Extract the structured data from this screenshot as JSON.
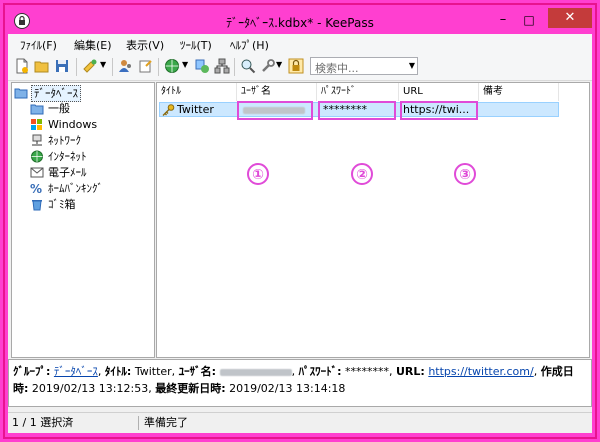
{
  "window": {
    "title": "ﾃﾞｰﾀﾍﾞｰｽ.kdbx* - KeePass",
    "minimize": "–",
    "maximize": "□",
    "close": "✕"
  },
  "menu": [
    "ﾌｧｲﾙ(F)",
    "編集(E)",
    "表示(V)",
    "ﾂｰﾙ(T)",
    "ﾍﾙﾌﾟ(H)"
  ],
  "toolbar": {
    "icons": [
      "new-file-icon",
      "open-folder-icon",
      "save-icon",
      "add-entry-icon",
      "dropdown-arrow",
      "user-copy-icon",
      "key-copy-icon",
      "globe-icon",
      "dropdown-arrow",
      "sync-icon",
      "network-icon",
      "find-icon",
      "tools-icon",
      "lock-icon"
    ],
    "search_placeholder": "検索中..."
  },
  "tree": {
    "root": "ﾃﾞｰﾀﾍﾞｰｽ",
    "items": [
      "一般",
      "Windows",
      "ﾈｯﾄﾜｰｸ",
      "ｲﾝﾀｰﾈｯﾄ",
      "電子ﾒｰﾙ",
      "ﾎｰﾑﾊﾞﾝｷﾝｸﾞ",
      "ｺﾞﾐ箱"
    ]
  },
  "list": {
    "columns": [
      "ﾀｲﾄﾙ",
      "ﾕｰｻﾞ名",
      "ﾊﾟｽﾜｰﾄﾞ",
      "URL",
      "備考"
    ],
    "rows": [
      {
        "title": "Twitter",
        "password": "********",
        "url": "https://twi..."
      }
    ]
  },
  "annotations": [
    "①",
    "②",
    "③"
  ],
  "info": {
    "group_label": "ｸﾞﾙｰﾌﾟ:",
    "group_value": "ﾃﾞｰﾀﾍﾞｰｽ",
    "title_label": "ﾀｲﾄﾙ:",
    "title_value": "Twitter,",
    "user_label": "ﾕｰｻﾞ名:",
    "pass_label": "ﾊﾟｽﾜｰﾄﾞ:",
    "pass_value": "********,",
    "url_label": "URL:",
    "url_value": "https://twitter.com/",
    "created_label": "作成日時:",
    "created_value": "2019/02/13 13:12:53,",
    "modified_label": "最終更新日時:",
    "modified_value": "2019/02/13 13:14:18"
  },
  "status": {
    "selection": "1 / 1 選択済",
    "state": "準備完了"
  },
  "colors": {
    "accent": "#e04bd8",
    "selection": "#cce8ff",
    "close": "#c43b3b"
  }
}
